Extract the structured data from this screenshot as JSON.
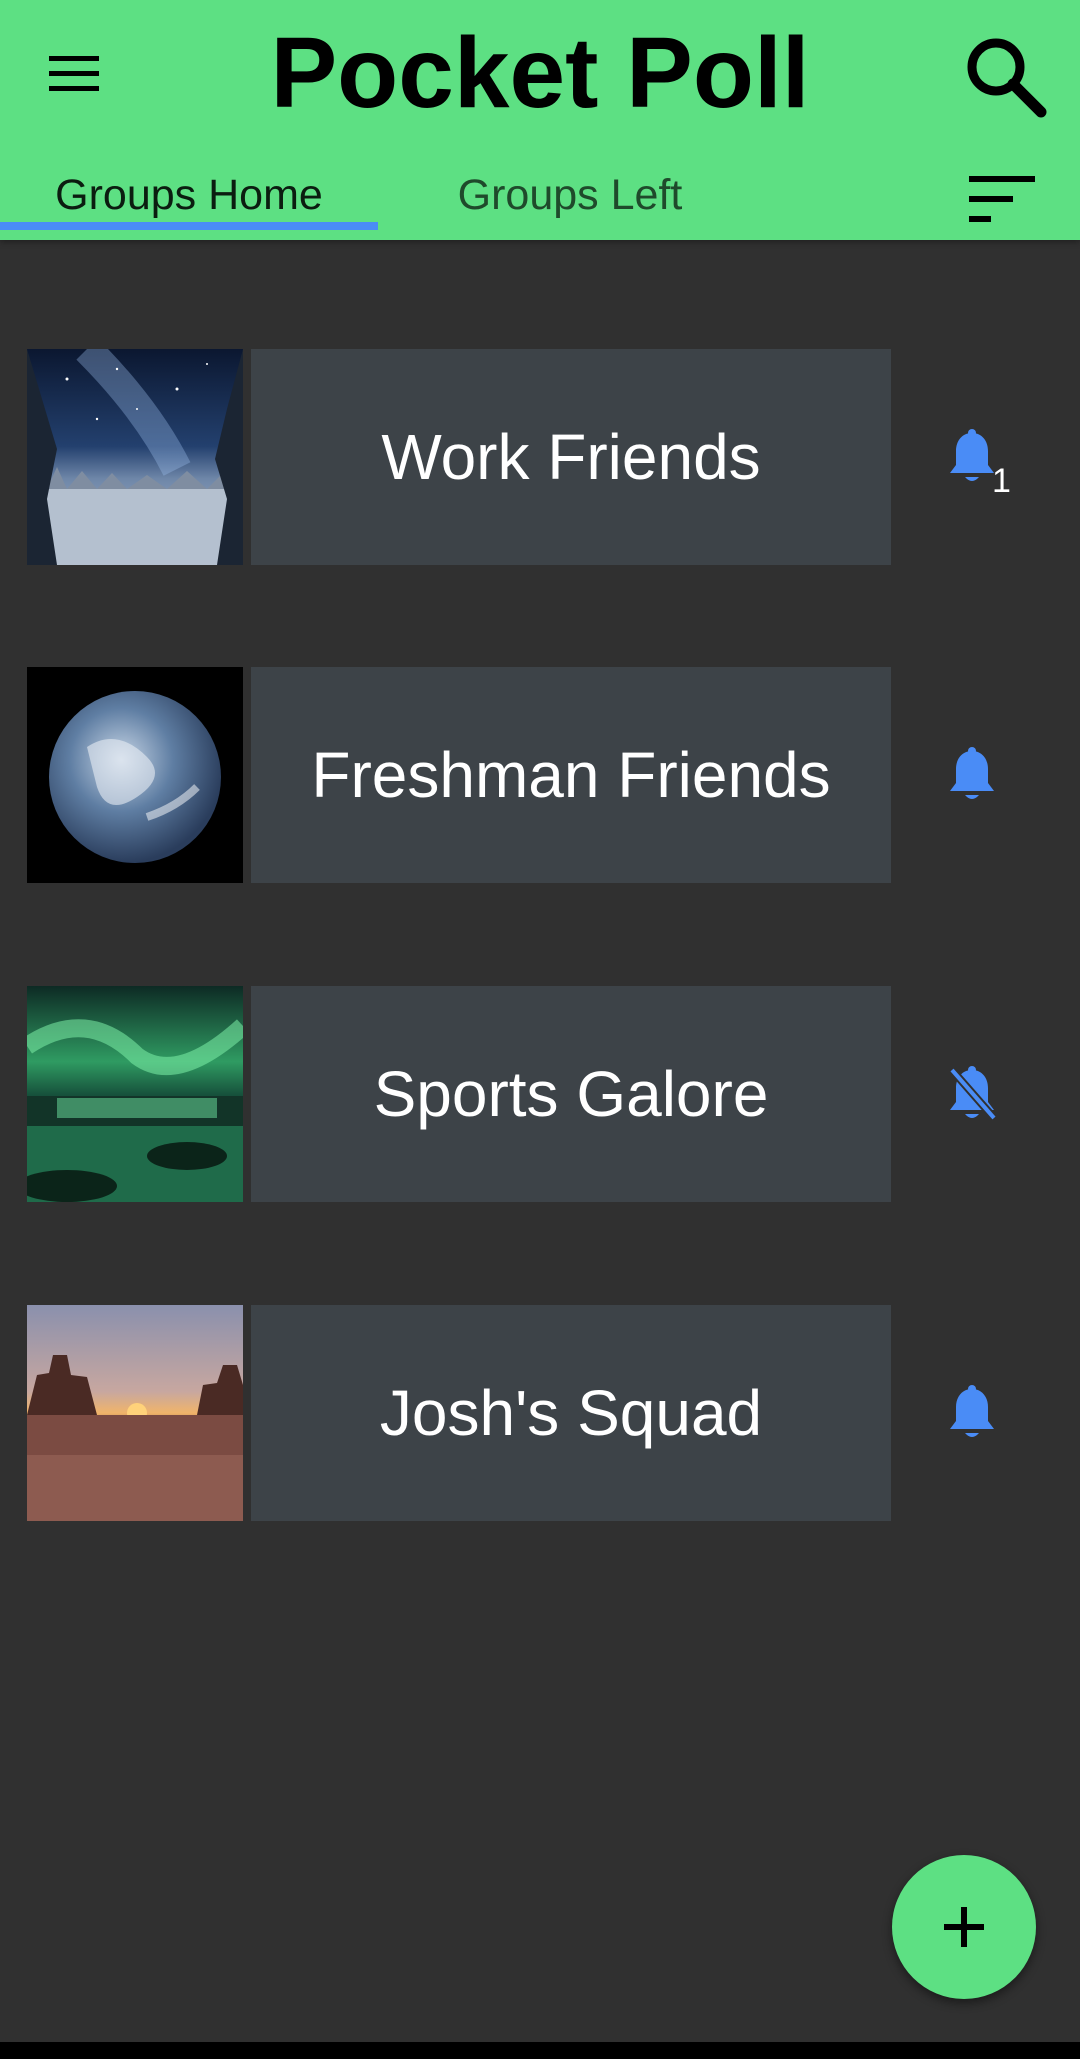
{
  "app": {
    "title": "Pocket Poll",
    "colors": {
      "header": "#5de083",
      "background": "#303030",
      "card": "#3d4348",
      "accent": "#4a8cf6"
    }
  },
  "header": {
    "menu_icon": "hamburger-menu-icon",
    "search_icon": "search-icon",
    "sort_icon": "sort-icon"
  },
  "tabs": [
    {
      "label": "Groups Home",
      "selected": true
    },
    {
      "label": "Groups Left",
      "selected": false
    }
  ],
  "groups": [
    {
      "name": "Work Friends",
      "image": "snowy-forest-night-sky",
      "notifications": "on",
      "badge": "1"
    },
    {
      "name": "Freshman Friends",
      "image": "earth-from-space",
      "notifications": "on",
      "badge": ""
    },
    {
      "name": "Sports Galore",
      "image": "aurora-over-waterfall",
      "notifications": "off",
      "badge": ""
    },
    {
      "name": "Josh's Squad",
      "image": "desert-sunset-monument-valley",
      "notifications": "on",
      "badge": ""
    }
  ],
  "fab": {
    "icon": "plus-icon"
  }
}
